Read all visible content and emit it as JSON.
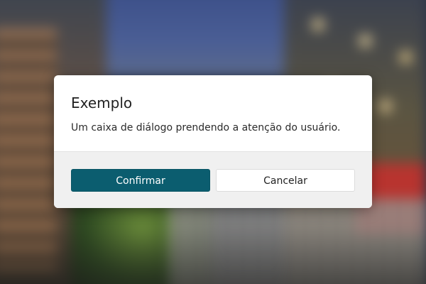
{
  "dialog": {
    "title": "Exemplo",
    "message": "Um caixa de diálogo prendendo a atenção do usuário.",
    "confirm_label": "Confirmar",
    "cancel_label": "Cancelar"
  },
  "colors": {
    "primary_button": "#0b5d6f",
    "dialog_background": "#ffffff",
    "footer_background": "#f0f0f0"
  }
}
